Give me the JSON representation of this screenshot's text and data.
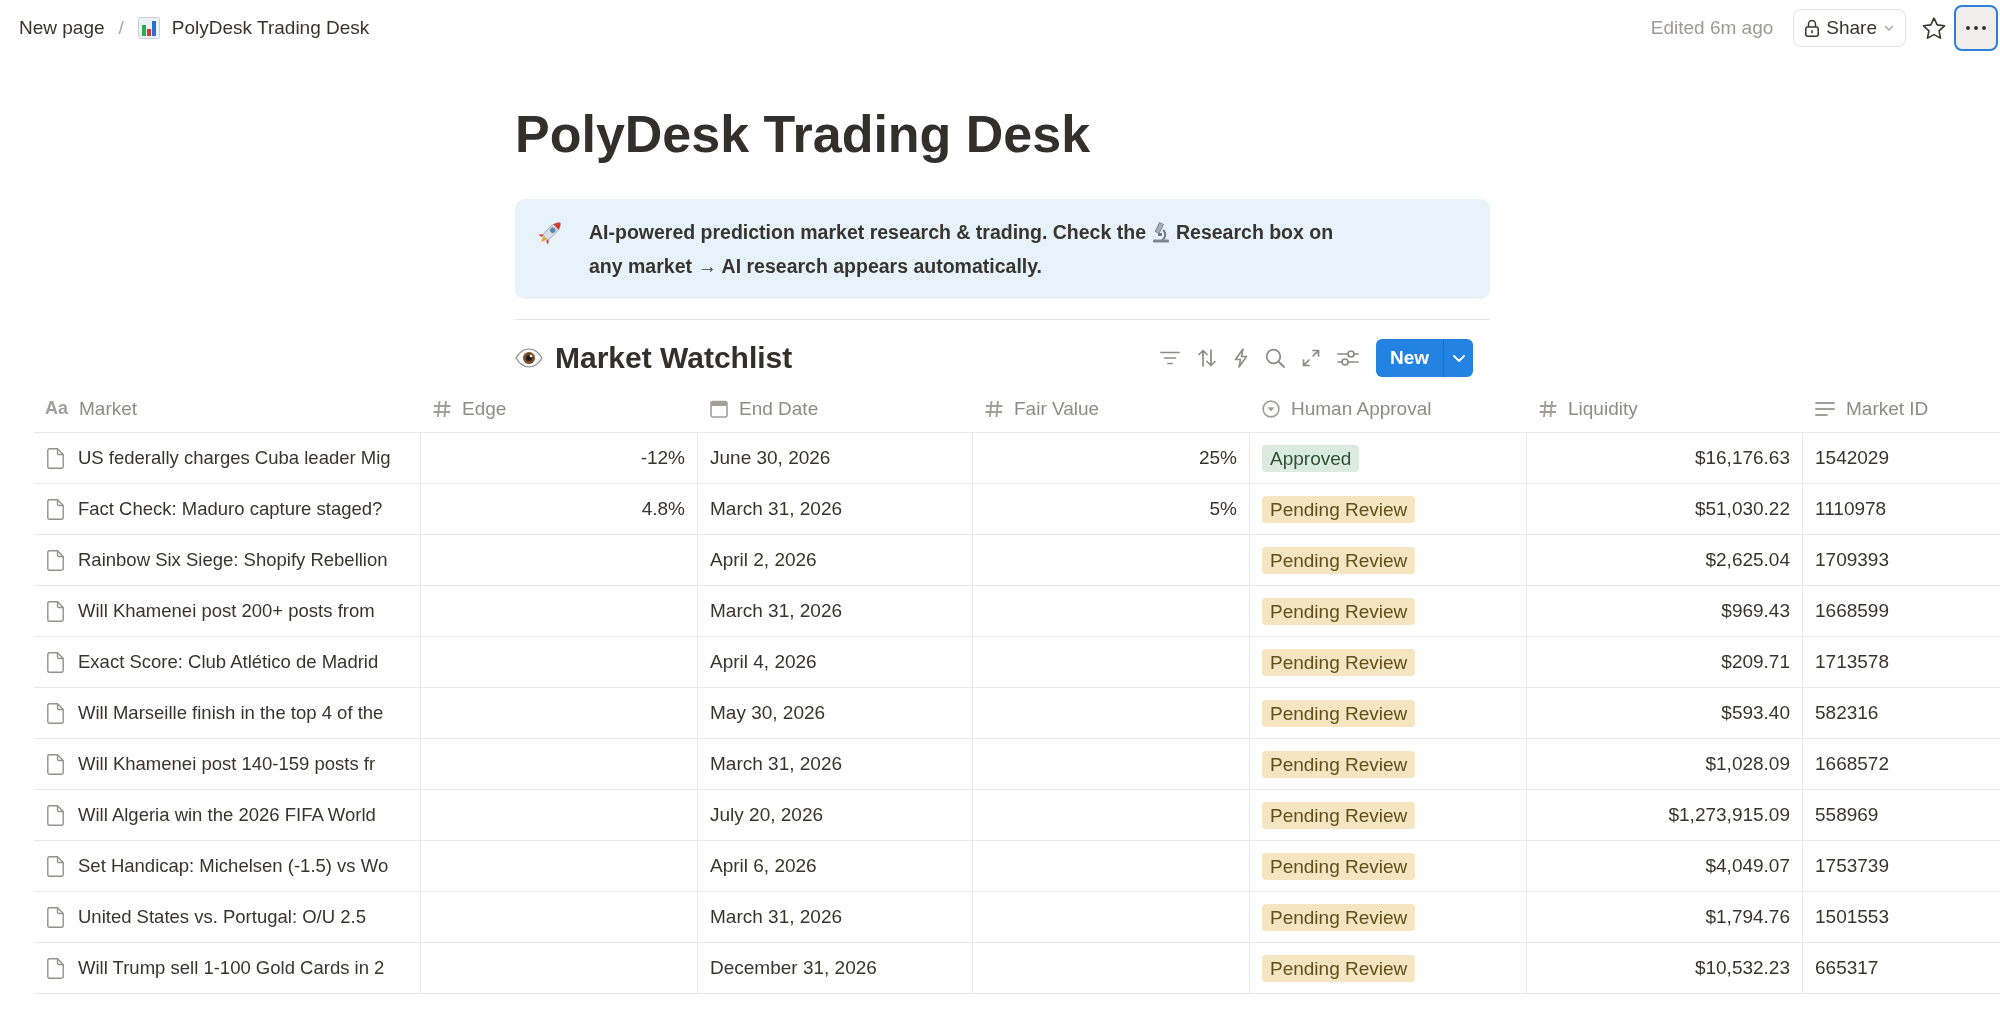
{
  "topbar": {
    "breadcrumbs": [
      {
        "label": "New page",
        "has_icon": false
      },
      {
        "label": "PolyDesk Trading Desk",
        "has_icon": true
      }
    ],
    "separator": "/",
    "edited": "Edited 6m ago",
    "share_button": "Share",
    "more_button": {
      "focused": true
    }
  },
  "page": {
    "title": "PolyDesk Trading Desk",
    "callout": {
      "text_runs": [
        "AI-powered prediction market research & trading. Check the",
        "Research box on",
        "any market → AI research appears automatically."
      ]
    }
  },
  "database": {
    "title": "Market Watchlist",
    "new_button": "New"
  },
  "table": {
    "columns": [
      {
        "name": "Market",
        "kind": "title",
        "icon_text": "Aa"
      },
      {
        "name": "Edge",
        "kind": "number"
      },
      {
        "name": "End Date",
        "kind": "date"
      },
      {
        "name": "Fair Value",
        "kind": "number"
      },
      {
        "name": "Human Approval",
        "kind": "status"
      },
      {
        "name": "Liquidity",
        "kind": "number"
      },
      {
        "name": "Market ID",
        "kind": "text"
      }
    ],
    "rows": [
      {
        "market": "US federally charges Cuba leader Mig",
        "edge": "-12%",
        "end_date": "June 30, 2026",
        "fair_value": "25%",
        "approval": {
          "label": "Approved",
          "color": "#dcebdf"
        },
        "liquidity": "$16,176.63",
        "market_id": "1542029"
      },
      {
        "market": "Fact Check: Maduro capture staged?",
        "edge": "4.8%",
        "end_date": "March 31, 2026",
        "fair_value": "5%",
        "approval": {
          "label": "Pending Review",
          "color": "#f5e5c0"
        },
        "liquidity": "$51,030.22",
        "market_id": "1110978"
      },
      {
        "market": "Rainbow Six Siege: Shopify Rebellion",
        "end_date": "April 2, 2026",
        "approval": {
          "label": "Pending Review",
          "color": "#f5e5c0"
        },
        "liquidity": "$2,625.04",
        "market_id": "1709393"
      },
      {
        "market": "Will Khamenei post 200+ posts from",
        "end_date": "March 31, 2026",
        "approval": {
          "label": "Pending Review",
          "color": "#f5e5c0"
        },
        "liquidity": "$969.43",
        "market_id": "1668599"
      },
      {
        "market": "Exact Score: Club Atlético de Madrid",
        "end_date": "April 4, 2026",
        "approval": {
          "label": "Pending Review",
          "color": "#f5e5c0"
        },
        "liquidity": "$209.71",
        "market_id": "1713578"
      },
      {
        "market": "Will Marseille finish in the top 4 of the",
        "end_date": "May 30, 2026",
        "approval": {
          "label": "Pending Review",
          "color": "#f5e5c0"
        },
        "liquidity": "$593.40",
        "market_id": "582316"
      },
      {
        "market": "Will Khamenei post 140-159 posts fr",
        "end_date": "March 31, 2026",
        "approval": {
          "label": "Pending Review",
          "color": "#f5e5c0"
        },
        "liquidity": "$1,028.09",
        "market_id": "1668572"
      },
      {
        "market": "Will Algeria win the 2026 FIFA World",
        "end_date": "July 20, 2026",
        "approval": {
          "label": "Pending Review",
          "color": "#f5e5c0"
        },
        "liquidity": "$1,273,915.09",
        "market_id": "558969"
      },
      {
        "market": "Set Handicap: Michelsen (-1.5) vs Wo",
        "end_date": "April 6, 2026",
        "approval": {
          "label": "Pending Review",
          "color": "#f5e5c0"
        },
        "liquidity": "$4,049.07",
        "market_id": "1753739"
      },
      {
        "market": "United States vs. Portugal: O/U 2.5",
        "end_date": "March 31, 2026",
        "approval": {
          "label": "Pending Review",
          "color": "#f5e5c0"
        },
        "liquidity": "$1,794.76",
        "market_id": "1501553"
      },
      {
        "market": "Will Trump sell 1-100 Gold Cards in 2",
        "end_date": "December 31, 2026",
        "approval": {
          "label": "Pending Review",
          "color": "#f5e5c0"
        },
        "liquidity": "$10,532.23",
        "market_id": "665317"
      }
    ]
  }
}
